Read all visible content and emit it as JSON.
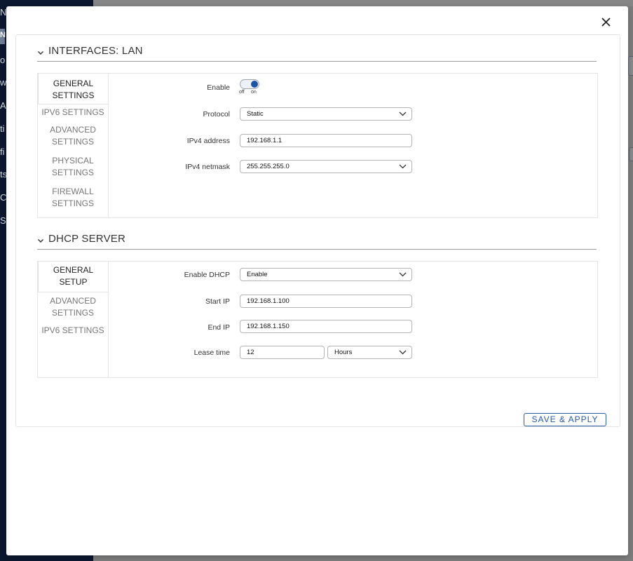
{
  "background": {
    "sidebar_fragments": [
      "N",
      "N",
      "o",
      "w",
      "AN",
      "ti",
      "fi",
      "ts",
      "C",
      "S"
    ]
  },
  "interfaces_section": {
    "title": "INTERFACES: LAN",
    "tabs": [
      {
        "label": "GENERAL SETTINGS",
        "active": true
      },
      {
        "label": "IPV6 SETTINGS",
        "active": false
      },
      {
        "label": "ADVANCED SETTINGS",
        "active": false
      },
      {
        "label": "PHYSICAL SETTINGS",
        "active": false
      },
      {
        "label": "FIREWALL SETTINGS",
        "active": false
      }
    ],
    "enable_label": "Enable",
    "enable_off": "off",
    "enable_on": "on",
    "enable_state": true,
    "protocol_label": "Protocol",
    "protocol_value": "Static",
    "ipv4_address_label": "IPv4 address",
    "ipv4_address_value": "192.168.1.1",
    "ipv4_netmask_label": "IPv4 netmask",
    "ipv4_netmask_value": "255.255.255.0"
  },
  "dhcp_section": {
    "title": "DHCP SERVER",
    "tabs": [
      {
        "label": "GENERAL SETUP",
        "active": true
      },
      {
        "label": "ADVANCED SETTINGS",
        "active": false
      },
      {
        "label": "IPV6 SETTINGS",
        "active": false
      }
    ],
    "enable_dhcp_label": "Enable DHCP",
    "enable_dhcp_value": "Enable",
    "start_ip_label": "Start IP",
    "start_ip_value": "192.168.1.100",
    "end_ip_label": "End IP",
    "end_ip_value": "192.168.1.150",
    "lease_time_label": "Lease time",
    "lease_time_value": "12",
    "lease_unit_value": "Hours"
  },
  "save_apply_label": "SAVE & APPLY",
  "colors": {
    "accent": "#2a5aa0",
    "toggle_on": "#1c55a6",
    "sidebar_bg": "#0c1730",
    "overlay_bg": "#7c7c7c"
  }
}
